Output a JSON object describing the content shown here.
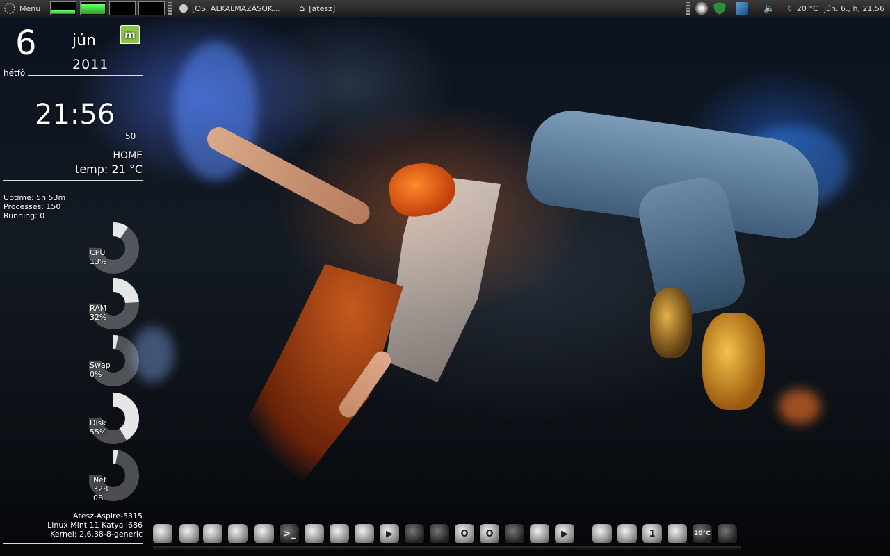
{
  "top_panel": {
    "menu_label": "Menu",
    "window_title": "[OS, ALKALMAZÁSOK...",
    "home_label": "[atesz]",
    "weather": "20 °C",
    "datetime": "jún. 6., h, 21.56",
    "system_monitor_levels": [
      0.3,
      0.85,
      0.0,
      0.0
    ]
  },
  "conky": {
    "day": "6",
    "month": "jún",
    "year": "2011",
    "weekday": "hétfő",
    "time": "21:56",
    "seconds": "50",
    "location": "HOME",
    "temp": "temp: 21 °C",
    "uptime": "Uptime: 5h 53m",
    "processes": "Processes: 150",
    "running": "Running: 0",
    "gauges": [
      {
        "name": "CPU",
        "value": "13%",
        "percent": 13
      },
      {
        "name": "RAM",
        "value": "32%",
        "percent": 32
      },
      {
        "name": "Swap",
        "value": "0%",
        "percent": 0
      },
      {
        "name": "Disk",
        "value": "55%",
        "percent": 55
      },
      {
        "name": "Net",
        "value": "32B",
        "value2": "0B",
        "percent": 0
      }
    ],
    "hostname": "Atesz-Aspire-5315",
    "os": "Linux Mint 11 Katya  i686",
    "kernel": "Kernel: 2.6.38-8-generic"
  },
  "dock": {
    "items": [
      {
        "icon": "gimp-icon"
      },
      {
        "icon": "text-editor-icon"
      },
      {
        "icon": "package-manager-icon"
      },
      {
        "icon": "settings-icon"
      },
      {
        "icon": "remove-icon"
      },
      {
        "icon": "terminal-icon",
        "glyph": ">_"
      },
      {
        "icon": "aperture-icon"
      },
      {
        "icon": "firefox-icon"
      },
      {
        "icon": "video-editor-icon"
      },
      {
        "icon": "play-icon",
        "glyph": "▶"
      },
      {
        "icon": "pen-icon"
      },
      {
        "icon": "thunderbird-icon"
      },
      {
        "icon": "opera-icon",
        "glyph": "O"
      },
      {
        "icon": "opera-next-icon",
        "glyph": "O"
      },
      {
        "icon": "browser-icon"
      },
      {
        "icon": "chat-icon"
      },
      {
        "icon": "media-player-icon",
        "glyph": "▶"
      },
      {
        "icon": "search-icon"
      },
      {
        "icon": "document-icon"
      },
      {
        "icon": "workspace-icon",
        "glyph": "1"
      },
      {
        "icon": "ubuntu-one-icon"
      },
      {
        "icon": "weather-icon",
        "glyph": "20°C"
      },
      {
        "icon": "power-icon"
      }
    ]
  },
  "colors": {
    "panel": "#2a2a2a",
    "monitor_green": "#3ed83e",
    "mint_green": "#8cc34a"
  }
}
